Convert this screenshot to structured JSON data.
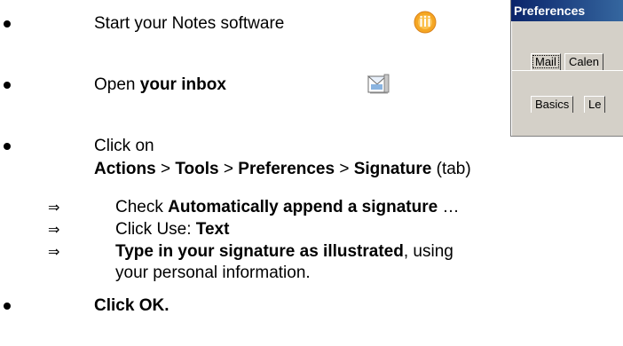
{
  "steps": [
    {
      "text": "Start your Notes software"
    },
    {
      "prefix": "Open ",
      "bold": "your inbox"
    },
    {
      "prefix": "Click on"
    }
  ],
  "path": {
    "actions": "Actions",
    "sep1": " > ",
    "tools": "Tools",
    "sep2": " > ",
    "preferences": "Preferences",
    "sep3": " > ",
    "signature": "Signature",
    "suffix": " (tab)"
  },
  "arrow_symbol": "⇒",
  "substeps": [
    {
      "prefix": "Check ",
      "bold": "Automatically append a signature",
      "suffix": " …"
    },
    {
      "prefix": "Click Use:  ",
      "bold": "Text"
    },
    {
      "bold": "Type in your signature as illustrated",
      "suffix": ", using",
      "line2": "your personal information."
    }
  ],
  "final_step": "Click OK.",
  "dialog": {
    "title": "Preferences",
    "tab_mail": "Mail",
    "tab_calendar": "Calen",
    "tab_basics": "Basics",
    "tab_letterhead": "Le"
  },
  "icons": {
    "notes": "lotus-notes-icon",
    "inbox": "inbox-icon"
  },
  "colors": {
    "notes_icon": "#f5a623",
    "titlebar": "#0a246a",
    "dialog_bg": "#d4d0c8"
  }
}
